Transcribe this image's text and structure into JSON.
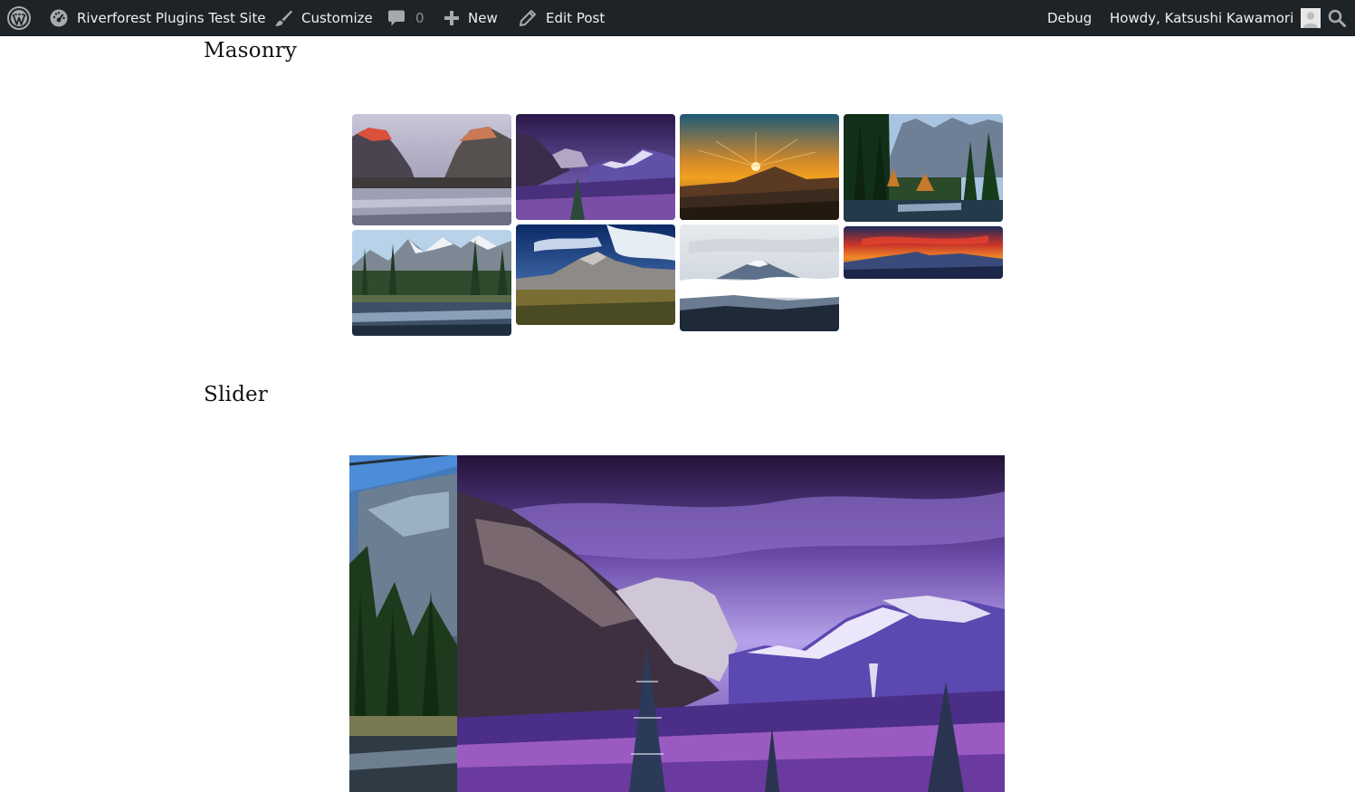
{
  "adminbar": {
    "site_name": "Riverforest Plugins Test Site",
    "customize_label": "Customize",
    "comments_count": "0",
    "new_label": "New",
    "edit_post_label": "Edit Post",
    "debug_label": "Debug",
    "howdy_label": "Howdy, Katsushi Kawamori"
  },
  "sections": {
    "masonry_title": "Masonry",
    "slider_title": "Slider"
  },
  "masonry": {
    "images": [
      {
        "name": "yosemite-sunset-river"
      },
      {
        "name": "purple-yosemite-valley"
      },
      {
        "name": "mount-fuji-sunrise"
      },
      {
        "name": "forest-cliffs-river"
      },
      {
        "name": "yosemite-river-pines"
      },
      {
        "name": "half-dome-blue-sky"
      },
      {
        "name": "mount-fuji-clouds"
      },
      {
        "name": "red-sky-mountains"
      }
    ]
  },
  "slider": {
    "slides": [
      {
        "name": "forest-cliffs-slide"
      },
      {
        "name": "purple-yosemite-slide"
      }
    ]
  },
  "colors": {
    "adminbar_bg": "#1d2327",
    "adminbar_text": "#f0f0f1",
    "adminbar_icon": "#a7aaad",
    "heading_text": "#111111"
  },
  "icons": [
    "wordpress-logo-icon",
    "dashboard-icon",
    "brush-icon",
    "comment-icon",
    "plus-icon",
    "pencil-icon",
    "avatar",
    "search-icon"
  ]
}
